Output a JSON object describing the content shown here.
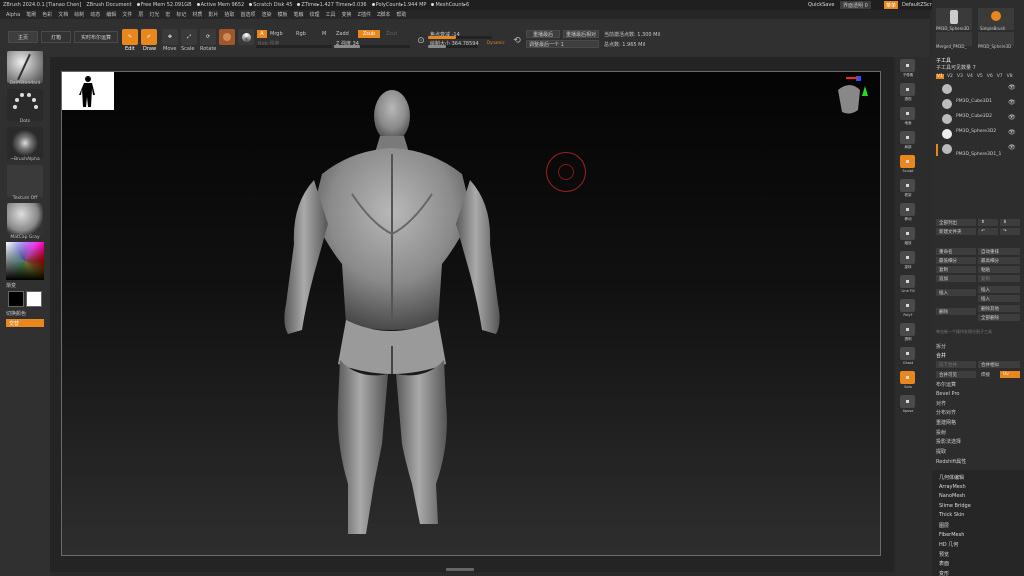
{
  "titlebar": {
    "app": "ZBrush 2024.0.1 [Tianao Chen]",
    "doc": "ZBrush Document",
    "free_mem": "Free Mem 52.091GB",
    "active_mem": "Active Mem 9652",
    "scratch": "Scratch Disk 45",
    "ztime": "ZTime▸1.427 Timer▸0.036",
    "poly": "PolyCount▸1.944 MP",
    "mesh": "MeshCount▸6",
    "quicksave": "QuickSave",
    "transparency": "界面透明 0",
    "menus_btn": "菜单",
    "script": "DefaultZScript"
  },
  "menubar": [
    "Alpha",
    "笔刷",
    "色彩",
    "文档",
    "绘制",
    "动态",
    "编辑",
    "文件",
    "层",
    "灯光",
    "宏",
    "标记",
    "材质",
    "影片",
    "拾取",
    "首选项",
    "渲染",
    "模板",
    "笔触",
    "纹理",
    "工具",
    "变换",
    "Z插件",
    "Z脚本",
    "帮助"
  ],
  "topshelf": {
    "home_tab": "主页",
    "lightbox": "灯箱",
    "live_bool": "实时布尔运算",
    "edit": "Edit",
    "draw": "Draw",
    "move": "Move",
    "scale": "Scale",
    "rotate": "Rotate",
    "a_label": "A",
    "mrgb": "Mrgb",
    "rgb": "Rgb",
    "m": "M",
    "zadd": "Zadd",
    "zsub": "Zsub",
    "zcut": "Zcut",
    "rgb_intensity": "Rgb 强度",
    "z_intensity": "Z 强度 34",
    "z_intensity_value": 34,
    "focal_shift": "焦点衰减 -14",
    "focal_shift_value": -14,
    "draw_size": "绘制大小 364.78594",
    "draw_size_value": 364.78594,
    "dynamic": "Dynamic",
    "replay_last": "重播最后",
    "replay_last_rel": "重播最后相对",
    "replay_up": "调整最后一个 1",
    "active_points": "当前激活点数: 1.300 Mil",
    "total_points": "总点数: 1.965 Mil"
  },
  "leftpanel": {
    "brush": "DamStandard",
    "stroke": "Dots",
    "alpha": "~BrushAlpha",
    "texture": "Texture Off",
    "material": "MatCap Gray",
    "gradient": "渐变",
    "switch_color": "切换颜色",
    "alternate": "交替"
  },
  "rightstrip": [
    "子像素",
    "透视",
    "地面",
    "局部",
    "Sculpt",
    "框架",
    "移动",
    "缩放",
    "旋转",
    "Line Fill",
    "PolyF",
    "透明",
    "Ghost",
    "Solo",
    "Xpose"
  ],
  "rightpanel": {
    "top_tools": [
      "PM3D_Sphere3D",
      "SimpleBrush",
      "Merged_PM3D_",
      "PM3D_Sphere3D"
    ],
    "subtool_header": "子工具",
    "subtool_count": "子工具可见数量 7",
    "versions": [
      "V1",
      "V2",
      "V3",
      "V4",
      "V5",
      "V6",
      "V7",
      "V8"
    ],
    "subtools": [
      "",
      "PM3D_Cube3D1",
      "PM3D_Cube3D2",
      "PM3D_Sphere3D2",
      "PM3D_Sphere3D1_1"
    ],
    "list_all": "全部列出",
    "new_folder": "新建文件夹",
    "rename": "重命名",
    "auto_reorder": "自动重排",
    "all_low": "最低细分",
    "all_high": "最高细分",
    "copy": "复制",
    "paste": "粘贴",
    "append": "追加",
    "duplicate": "复制",
    "insert": "插入",
    "delete": "删除",
    "del_other": "删除其他",
    "del_all": "全部删除",
    "hint": "单击新一个操作处理分割子工具",
    "split": "拆分",
    "merge": "合并",
    "merge_down": "向下合并",
    "merge_similar": "合并相似",
    "merge_visible": "合并可见",
    "weld": "焊接",
    "uv": "Uv",
    "boolean": "布尔运算",
    "bevel_pro": "Bevel Pro",
    "align": "对齐",
    "distribute": "分布对齐",
    "remesh": "重建网格",
    "project": "投射",
    "project_bp": "投影法选择",
    "extract": "提取",
    "geometry_menu": [
      "几何体编辑",
      "ArrayMesh",
      "NanoMesh",
      "Slime Bridge",
      "Thick Skin",
      "图层",
      "FiberMesh",
      "HD 几何",
      "预览",
      "表面",
      "变形"
    ]
  }
}
